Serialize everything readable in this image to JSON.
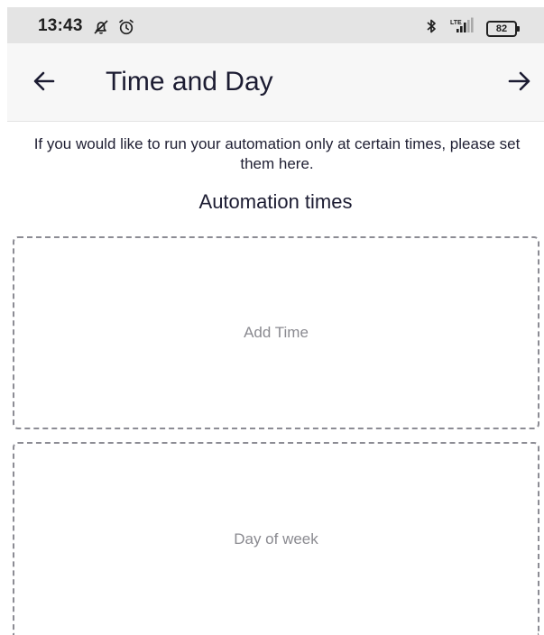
{
  "status_bar": {
    "time": "13:43",
    "battery": "82",
    "network": "LTE"
  },
  "app_bar": {
    "title": "Time and Day"
  },
  "content": {
    "intro": "If you would like to run your automation only at certain times, please set them here.",
    "section_heading": "Automation times",
    "add_time_label": "Add Time",
    "day_of_week_label": "Day of week"
  },
  "icons": {
    "back": "arrow-left-icon",
    "forward": "arrow-right-icon",
    "muted": "bell-off-icon",
    "alarm": "alarm-icon",
    "bluetooth": "bluetooth-icon",
    "signal": "signal-icon"
  }
}
